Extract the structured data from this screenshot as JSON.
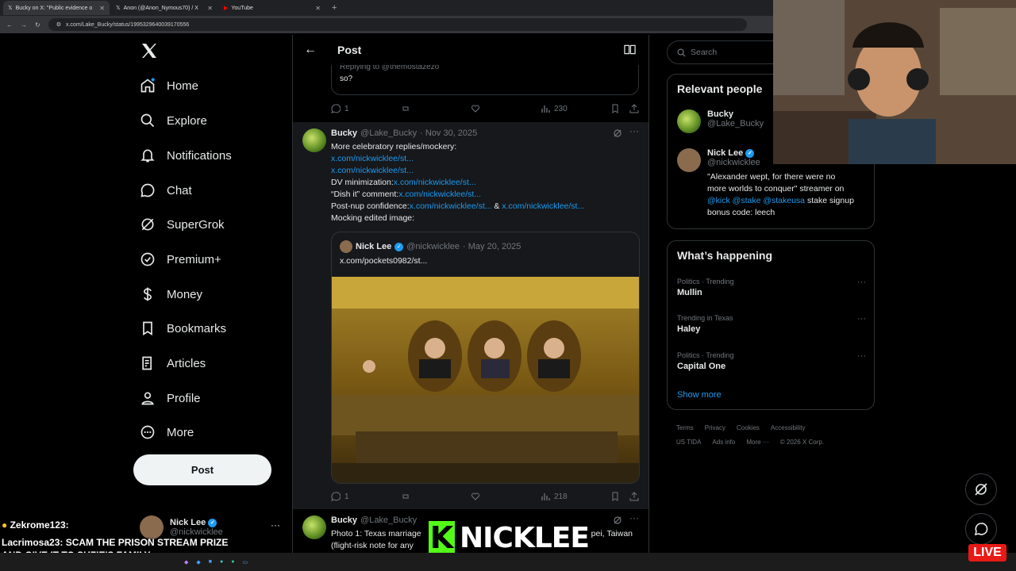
{
  "browser": {
    "tabs": [
      {
        "label": "Bucky on X: \"Public evidence o",
        "active": true
      },
      {
        "label": "Anon (@Anon_Nymous70) / X",
        "active": false
      },
      {
        "label": "YouTube",
        "active": false
      }
    ],
    "url": "x.com/Lake_Bucky/status/1995329640039170556"
  },
  "nav": {
    "items": [
      {
        "label": "Home",
        "icon": "home-icon"
      },
      {
        "label": "Explore",
        "icon": "search-icon"
      },
      {
        "label": "Notifications",
        "icon": "bell-icon"
      },
      {
        "label": "Chat",
        "icon": "chat-icon"
      },
      {
        "label": "SuperGrok",
        "icon": "grok-icon"
      },
      {
        "label": "Premium+",
        "icon": "premium-icon"
      },
      {
        "label": "Money",
        "icon": "money-icon"
      },
      {
        "label": "Bookmarks",
        "icon": "bookmark-icon"
      },
      {
        "label": "Articles",
        "icon": "articles-icon"
      },
      {
        "label": "Profile",
        "icon": "profile-icon"
      },
      {
        "label": "More",
        "icon": "more-circle-icon"
      }
    ],
    "post_label": "Post",
    "account": {
      "name": "Nick Lee",
      "handle": "@nickwicklee"
    }
  },
  "header": {
    "title": "Post"
  },
  "prev_quote": {
    "reply_to": "Replying to @themostazezo",
    "text": "so?"
  },
  "prev_actions": {
    "replies": "1",
    "views": "230"
  },
  "tweet": {
    "name": "Bucky",
    "handle": "@Lake_Bucky",
    "date": "· Nov 30, 2025",
    "line1": "More celebratory replies/mockery:",
    "link1": "x.com/nickwicklee/st...",
    "link2": "x.com/nickwicklee/st...",
    "l3_prefix": "DV minimization:",
    "l3_link": "x.com/nickwicklee/st...",
    "l4_prefix": "“Dish it” comment:",
    "l4_link": "x.com/nickwicklee/st...",
    "l5_prefix": "Post-nup confidence:",
    "l5_link": "x.com/nickwicklee/st...",
    "l5_amp": " & ",
    "l5_link2": "x.com/nickwicklee/st...",
    "line6": "Mocking edited image:",
    "quote": {
      "name": "Nick Lee",
      "handle": "@nickwicklee",
      "date": "· May 20, 2025",
      "text": "x.com/pockets0982/st..."
    },
    "actions": {
      "replies": "1",
      "views": "218"
    }
  },
  "tweet2": {
    "name": "Bucky",
    "handle": "@Lake_Bucky",
    "line1": "Photo 1: Texas marriage",
    "line1_end": "pei, Taiwan",
    "line2": "(flight-risk note for any"
  },
  "right": {
    "search_placeholder": "Search",
    "relevant_title": "Relevant people",
    "people": [
      {
        "name": "Bucky",
        "handle": "@Lake_Bucky"
      },
      {
        "name": "Nick Lee",
        "handle": "@nickwicklee",
        "bio_1": "\"Alexander wept, for there were no",
        "bio_2": "more worlds to conquer\" streamer on",
        "bio_3_links": "@kick @stake @stakeusa",
        "bio_3_rest": " stake signup",
        "bio_4": "bonus code: leech"
      }
    ],
    "happening_title": "What’s happening",
    "trends": [
      {
        "category": "Politics · Trending",
        "name": "Mullin"
      },
      {
        "category": "Trending in Texas",
        "name": "Haley"
      },
      {
        "category": "Politics · Trending",
        "name": "Capital One"
      }
    ],
    "show_more": "Show more",
    "footer1": [
      "Terms",
      "Privacy",
      "Cookies",
      "Accessibility"
    ],
    "footer2": [
      "US TIDA",
      "Ads info",
      "More ···",
      "© 2026 X Corp."
    ]
  },
  "stream": {
    "chat_line1": "Zekrome123:",
    "chat_line2": "Lacrimosa23: SCAM THE PRISON STREAM PRIZE",
    "chat_line3": "AND GIVE IT TO SUZIE'S FAMILY",
    "banner_k": "K",
    "banner_name": "NICKLEE",
    "live": "LIVE"
  }
}
